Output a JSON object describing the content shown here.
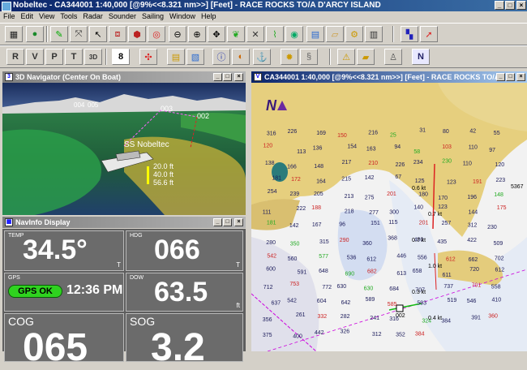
{
  "window": {
    "title": "Nobeltec - CA344001 1:40,000 [@9%<<8.321 nm>>] [Feet] - RACE ROCKS TO/A D'ARCY ISLAND",
    "minimize": "_",
    "maximize": "□",
    "close": "×"
  },
  "menu": [
    "File",
    "Edit",
    "View",
    "Tools",
    "Radar",
    "Sounder",
    "Sailing",
    "Window",
    "Help"
  ],
  "toolbar2": {
    "btn_8": "8",
    "btn_r": "R",
    "btn_v": "V",
    "btn_p": "P",
    "btn_t": "T",
    "btn_3d": "3D",
    "btn_n": "N"
  },
  "navigator3d": {
    "title": "3D Navigator (Center On Boat)",
    "boat_label": "SS Nobeltec",
    "waypoints": [
      "004",
      "005",
      "003",
      "002"
    ],
    "depths": [
      "20.0 ft",
      "40.0 ft",
      "56.6 ft"
    ]
  },
  "navinfo": {
    "title": "NavInfo Display",
    "temp": {
      "label": "TEMP",
      "value": "34.5°",
      "unit": "T"
    },
    "hdg": {
      "label": "HDG",
      "value": "066",
      "unit": "T"
    },
    "gps": {
      "label": "GPS",
      "status": "GPS OK",
      "time": "12:36 PM"
    },
    "dow": {
      "label": "DOW",
      "value": "63.5",
      "unit": "ft"
    },
    "cog": {
      "label": "COG",
      "value": "065"
    },
    "sog": {
      "label": "SOG",
      "value": "3.2"
    }
  },
  "chart": {
    "title": "CA344001 1:40,000 [@9%<<8.321 nm>>] [Feet] - RACE ROCKS TO/A",
    "north": "N",
    "soundings": [
      "316",
      "226",
      "169",
      "150",
      "216",
      "25",
      "31",
      "80",
      "42",
      "55",
      "120",
      "113",
      "136",
      "154",
      "163",
      "94",
      "58",
      "103",
      "110",
      "97",
      "138",
      "166",
      "148",
      "217",
      "210",
      "226",
      "234",
      "230",
      "110",
      "120",
      "181",
      "172",
      "164",
      "215",
      "142",
      "67",
      "125",
      "123",
      "191",
      "223",
      "254",
      "239",
      "205",
      "213",
      "275",
      "201",
      "180",
      "170",
      "196",
      "148",
      "111",
      "222",
      "188",
      "218",
      "277",
      "300",
      "140",
      "123",
      "144",
      "175",
      "181",
      "142",
      "167",
      "96",
      "151",
      "115",
      "201",
      "257",
      "312",
      "230",
      "280",
      "350",
      "315",
      "290",
      "360",
      "368",
      "400",
      "435",
      "422",
      "509",
      "542",
      "560",
      "577",
      "536",
      "612",
      "446",
      "556",
      "612",
      "662",
      "702",
      "600",
      "591",
      "648",
      "690",
      "682",
      "613",
      "658",
      "611",
      "720",
      "612",
      "712",
      "753",
      "772",
      "630",
      "630",
      "684",
      "707",
      "737",
      "701",
      "558",
      "637",
      "542",
      "604",
      "642",
      "589",
      "585",
      "593",
      "519",
      "546",
      "410",
      "356",
      "261",
      "332",
      "282",
      "241",
      "316",
      "324",
      "384",
      "391",
      "360",
      "375",
      "400",
      "442",
      "326",
      "312",
      "352",
      "384"
    ],
    "current_labels": [
      "0.6 kt",
      "0.7 kt",
      "0.7 kt",
      "1.0 kt",
      "0.3 kt",
      "0.4 kt"
    ],
    "waypoint_label": "002",
    "side_number": "5367"
  }
}
